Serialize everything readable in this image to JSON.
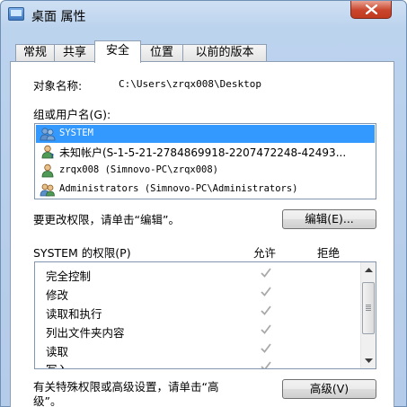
{
  "window": {
    "title": "桌面 属性"
  },
  "tabs": [
    {
      "label": "常规",
      "active": false
    },
    {
      "label": "共享",
      "active": false
    },
    {
      "label": "安全",
      "active": true
    },
    {
      "label": "位置",
      "active": false
    },
    {
      "label": "以前的版本",
      "active": false
    }
  ],
  "object": {
    "label": "对象名称:",
    "value": "C:\\Users\\zrqx008\\Desktop"
  },
  "groups": {
    "label": "组或用户名(G):",
    "items": [
      {
        "text": "SYSTEM",
        "icon": "system-users-icon",
        "selected": true
      },
      {
        "text": "未知帐户(S-1-5-21-2784869918-2207472248-42493...",
        "icon": "unknown-user-icon",
        "selected": false
      },
      {
        "text": "zrqx008 (Simnovo-PC\\zrqx008)",
        "icon": "user-icon",
        "selected": false
      },
      {
        "text": "Administrators (Simnovo-PC\\Administrators)",
        "icon": "admin-group-icon",
        "selected": false
      }
    ]
  },
  "edit": {
    "hint": "要更改权限，请单击“编辑”。",
    "button_label": "编辑(E)..."
  },
  "permissions": {
    "title": "SYSTEM 的权限(P)",
    "allow_header": "允许",
    "deny_header": "拒绝",
    "rows": [
      {
        "name": "完全控制",
        "allow": true
      },
      {
        "name": "修改",
        "allow": true
      },
      {
        "name": "读取和执行",
        "allow": true
      },
      {
        "name": "列出文件夹内容",
        "allow": true
      },
      {
        "name": "读取",
        "allow": true
      },
      {
        "name": "写入",
        "allow": true
      }
    ]
  },
  "advanced": {
    "hint_line1": "有关特殊权限或高级设置，请单击“高",
    "hint_line2": "级”。",
    "button_label": "高级(V)"
  },
  "colors": {
    "selection": "#3399ff",
    "check": "#a9a9a9",
    "close": "#c9452b"
  }
}
